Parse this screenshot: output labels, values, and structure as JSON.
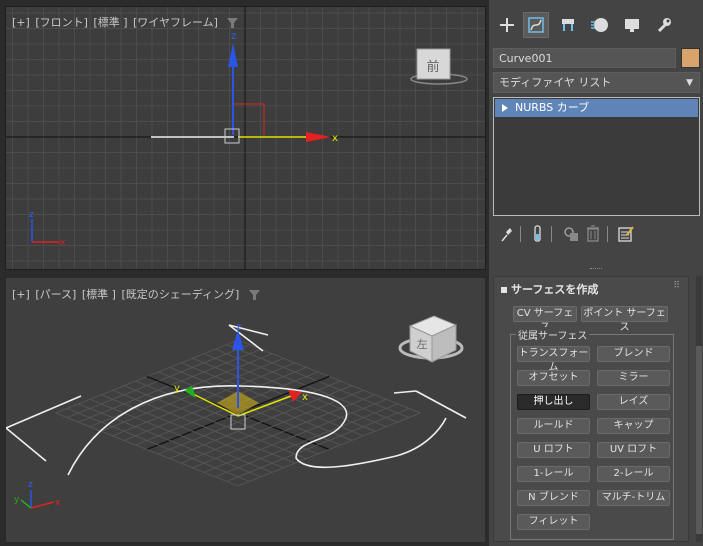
{
  "viewports": {
    "front": {
      "labels": [
        "[+]",
        "[フロント]",
        "[標準 ]",
        "[ワイヤフレーム]"
      ],
      "viewcube_face": "前"
    },
    "perspective": {
      "labels": [
        "[+]",
        "[パース]",
        "[標準 ]",
        "[既定のシェーディング]"
      ],
      "viewcube_face": "左"
    },
    "axes": {
      "x": "x",
      "y": "y",
      "z": "z"
    }
  },
  "panel": {
    "tabs": [
      "create-icon",
      "modify-icon",
      "hierarchy-icon",
      "motion-icon",
      "display-icon",
      "utilities-icon"
    ],
    "object_name": "Curve001",
    "object_color": "#d9a46b",
    "modifier_list": "モディファイヤ リスト",
    "stack_item": "NURBS カーブ",
    "rollout": {
      "title": "サーフェスを作成",
      "cv_surface": "CV サーフェス",
      "point_surface": "ポイント サーフェス",
      "dependent_group": "従属サーフェス",
      "buttons": [
        "トランスフォーム",
        "ブレンド",
        "オフセット",
        "ミラー",
        "押し出し",
        "レイズ",
        "ルールド",
        "キャップ",
        "U ロフト",
        "UV ロフト",
        "1-レール",
        "2-レール",
        "N ブレンド",
        "マルチ-トリム",
        "フィレット"
      ],
      "pressed_button": "押し出し"
    }
  }
}
